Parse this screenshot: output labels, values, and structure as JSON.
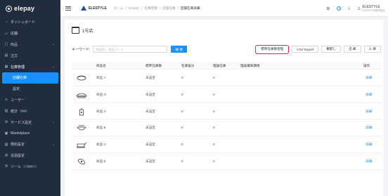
{
  "app": {
    "logo_text": "elepay"
  },
  "sidebar": {
    "items": [
      {
        "label": "ダッシュボード",
        "icon": "dashboard-icon",
        "glyph": "◔",
        "chevron": false,
        "badge": ""
      },
      {
        "label": "店舗",
        "icon": "store-icon",
        "glyph": "▭",
        "chevron": false,
        "badge": ""
      },
      {
        "label": "商品",
        "icon": "product-icon",
        "glyph": "▢",
        "chevron": true,
        "badge": ""
      },
      {
        "label": "注文",
        "icon": "order-icon",
        "glyph": "▤",
        "chevron": false,
        "badge": ""
      },
      {
        "label": "在庫管理",
        "icon": "inventory-icon",
        "glyph": "▦",
        "chevron": true,
        "badge": "",
        "section": true
      },
      {
        "label": "店舗在庫",
        "icon": "",
        "glyph": "",
        "chevron": false,
        "badge": "",
        "active": true
      },
      {
        "label": "設定",
        "icon": "",
        "glyph": "",
        "chevron": false,
        "badge": "",
        "sub": true
      },
      {
        "label": "ユーザー",
        "icon": "user-icon",
        "glyph": "♙",
        "chevron": false,
        "badge": ""
      },
      {
        "label": "統計",
        "icon": "stats-icon",
        "glyph": "▥",
        "chevron": false,
        "badge": "New"
      },
      {
        "label": "サービス設定",
        "icon": "service-icon",
        "glyph": "⚙",
        "chevron": true,
        "badge": ""
      },
      {
        "label": "Marketplace",
        "icon": "marketplace-icon",
        "glyph": "▣",
        "chevron": false,
        "badge": ""
      },
      {
        "label": "規約設定",
        "icon": "terms-icon",
        "glyph": "▧",
        "chevron": true,
        "badge": ""
      },
      {
        "label": "言語設定",
        "icon": "language-icon",
        "glyph": "◍",
        "chevron": false,
        "badge": ""
      },
      {
        "label": "ツール",
        "icon": "tool-icon",
        "glyph": "⚒",
        "chevron": false,
        "badge": "Beta"
      }
    ]
  },
  "topbar": {
    "brand": "ELESTYLE",
    "breadcrumb": [
      "ホーム",
      "OneQA",
      "在庫管理",
      "店舗在庫"
    ],
    "breadcrumb_current": "店舗在庫詳細",
    "help": "?",
    "user_name": "ELESTYLE",
    "user_sub": "ELESTYLE株式会社",
    "icons": [
      "menu-icon",
      "grid-icon",
      "help-icon",
      "download-icon",
      "user-icon"
    ]
  },
  "store": {
    "name": "1号店"
  },
  "toolbar": {
    "keyword_label": "キーワード:",
    "keyword_placeholder": "商品名、商品コード",
    "search_label": "検 索",
    "buttons": [
      "標準在庫数管理",
      "CSV Export",
      "棚卸し",
      "出 庫",
      "入 庫"
    ]
  },
  "table": {
    "headers": [
      "商品名",
      "標準在庫数",
      "在庫差分",
      "理論在庫",
      "理論賞味期限",
      "操作"
    ],
    "rows": [
      {
        "thumb": "sushi-icon",
        "name": "商品 A",
        "standard": "未設定",
        "diff": "0",
        "theory": "0",
        "expiry": "",
        "action": "詳細"
      },
      {
        "thumb": "burger-icon",
        "name": "商品 O",
        "standard": "未設定",
        "diff": "0",
        "theory": "0",
        "expiry": "",
        "action": "詳細"
      },
      {
        "thumb": "drink-icon",
        "name": "商品 G",
        "standard": "未設定",
        "diff": "0",
        "theory": "0",
        "expiry": "",
        "action": "詳細"
      },
      {
        "thumb": "bowl-icon",
        "name": "商品 B",
        "standard": "未設定",
        "diff": "0",
        "theory": "0",
        "expiry": "",
        "action": "詳細"
      },
      {
        "thumb": "pot-icon",
        "name": "商品 C",
        "standard": "未設定",
        "diff": "0",
        "theory": "0",
        "expiry": "",
        "action": "詳細"
      },
      {
        "thumb": "roll-icon",
        "name": "商品 E",
        "standard": "未設定",
        "diff": "0",
        "theory": "0",
        "expiry": "",
        "action": "詳細"
      }
    ]
  }
}
